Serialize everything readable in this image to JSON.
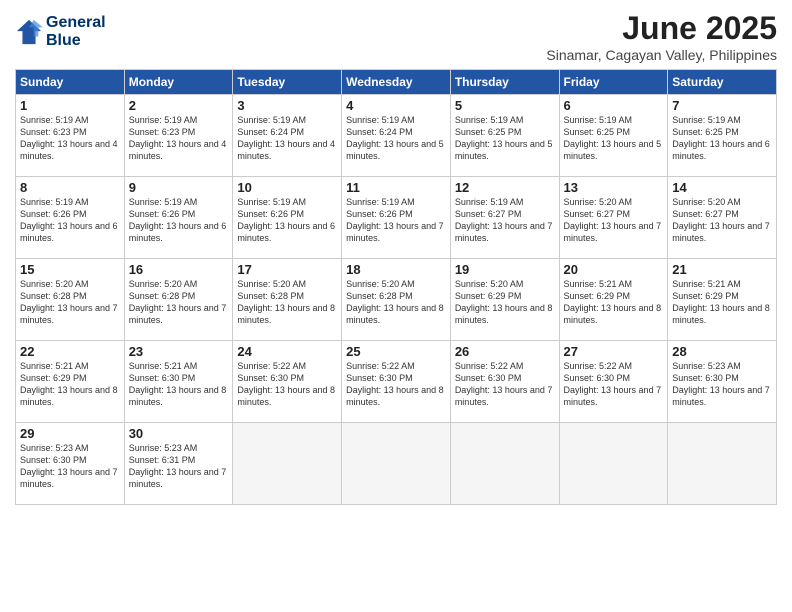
{
  "logo": {
    "line1": "General",
    "line2": "Blue"
  },
  "title": "June 2025",
  "subtitle": "Sinamar, Cagayan Valley, Philippines",
  "headers": [
    "Sunday",
    "Monday",
    "Tuesday",
    "Wednesday",
    "Thursday",
    "Friday",
    "Saturday"
  ],
  "weeks": [
    [
      {
        "day": "1",
        "sunrise": "5:19 AM",
        "sunset": "6:23 PM",
        "daylight": "13 hours and 4 minutes."
      },
      {
        "day": "2",
        "sunrise": "5:19 AM",
        "sunset": "6:23 PM",
        "daylight": "13 hours and 4 minutes."
      },
      {
        "day": "3",
        "sunrise": "5:19 AM",
        "sunset": "6:24 PM",
        "daylight": "13 hours and 4 minutes."
      },
      {
        "day": "4",
        "sunrise": "5:19 AM",
        "sunset": "6:24 PM",
        "daylight": "13 hours and 5 minutes."
      },
      {
        "day": "5",
        "sunrise": "5:19 AM",
        "sunset": "6:25 PM",
        "daylight": "13 hours and 5 minutes."
      },
      {
        "day": "6",
        "sunrise": "5:19 AM",
        "sunset": "6:25 PM",
        "daylight": "13 hours and 5 minutes."
      },
      {
        "day": "7",
        "sunrise": "5:19 AM",
        "sunset": "6:25 PM",
        "daylight": "13 hours and 6 minutes."
      }
    ],
    [
      {
        "day": "8",
        "sunrise": "5:19 AM",
        "sunset": "6:26 PM",
        "daylight": "13 hours and 6 minutes."
      },
      {
        "day": "9",
        "sunrise": "5:19 AM",
        "sunset": "6:26 PM",
        "daylight": "13 hours and 6 minutes."
      },
      {
        "day": "10",
        "sunrise": "5:19 AM",
        "sunset": "6:26 PM",
        "daylight": "13 hours and 6 minutes."
      },
      {
        "day": "11",
        "sunrise": "5:19 AM",
        "sunset": "6:26 PM",
        "daylight": "13 hours and 7 minutes."
      },
      {
        "day": "12",
        "sunrise": "5:19 AM",
        "sunset": "6:27 PM",
        "daylight": "13 hours and 7 minutes."
      },
      {
        "day": "13",
        "sunrise": "5:20 AM",
        "sunset": "6:27 PM",
        "daylight": "13 hours and 7 minutes."
      },
      {
        "day": "14",
        "sunrise": "5:20 AM",
        "sunset": "6:27 PM",
        "daylight": "13 hours and 7 minutes."
      }
    ],
    [
      {
        "day": "15",
        "sunrise": "5:20 AM",
        "sunset": "6:28 PM",
        "daylight": "13 hours and 7 minutes."
      },
      {
        "day": "16",
        "sunrise": "5:20 AM",
        "sunset": "6:28 PM",
        "daylight": "13 hours and 7 minutes."
      },
      {
        "day": "17",
        "sunrise": "5:20 AM",
        "sunset": "6:28 PM",
        "daylight": "13 hours and 8 minutes."
      },
      {
        "day": "18",
        "sunrise": "5:20 AM",
        "sunset": "6:28 PM",
        "daylight": "13 hours and 8 minutes."
      },
      {
        "day": "19",
        "sunrise": "5:20 AM",
        "sunset": "6:29 PM",
        "daylight": "13 hours and 8 minutes."
      },
      {
        "day": "20",
        "sunrise": "5:21 AM",
        "sunset": "6:29 PM",
        "daylight": "13 hours and 8 minutes."
      },
      {
        "day": "21",
        "sunrise": "5:21 AM",
        "sunset": "6:29 PM",
        "daylight": "13 hours and 8 minutes."
      }
    ],
    [
      {
        "day": "22",
        "sunrise": "5:21 AM",
        "sunset": "6:29 PM",
        "daylight": "13 hours and 8 minutes."
      },
      {
        "day": "23",
        "sunrise": "5:21 AM",
        "sunset": "6:30 PM",
        "daylight": "13 hours and 8 minutes."
      },
      {
        "day": "24",
        "sunrise": "5:22 AM",
        "sunset": "6:30 PM",
        "daylight": "13 hours and 8 minutes."
      },
      {
        "day": "25",
        "sunrise": "5:22 AM",
        "sunset": "6:30 PM",
        "daylight": "13 hours and 8 minutes."
      },
      {
        "day": "26",
        "sunrise": "5:22 AM",
        "sunset": "6:30 PM",
        "daylight": "13 hours and 7 minutes."
      },
      {
        "day": "27",
        "sunrise": "5:22 AM",
        "sunset": "6:30 PM",
        "daylight": "13 hours and 7 minutes."
      },
      {
        "day": "28",
        "sunrise": "5:23 AM",
        "sunset": "6:30 PM",
        "daylight": "13 hours and 7 minutes."
      }
    ],
    [
      {
        "day": "29",
        "sunrise": "5:23 AM",
        "sunset": "6:30 PM",
        "daylight": "13 hours and 7 minutes."
      },
      {
        "day": "30",
        "sunrise": "5:23 AM",
        "sunset": "6:31 PM",
        "daylight": "13 hours and 7 minutes."
      },
      null,
      null,
      null,
      null,
      null
    ]
  ]
}
